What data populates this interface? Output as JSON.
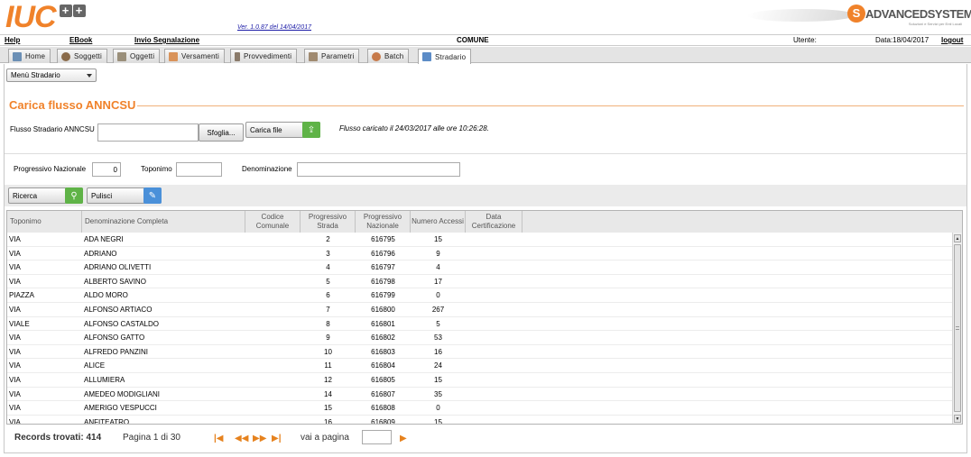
{
  "header": {
    "logo_text": "IUC",
    "logo_plus": [
      "+",
      "+"
    ],
    "version": "Ver. 1.0.87 del 14/04/2017",
    "brand_name": "ADVANCEDSYSTEMS",
    "brand_sub": "Soluzioni e Servizi per Enti Locali"
  },
  "topbar": {
    "help": "Help",
    "ebook": "EBook",
    "invio": "Invio Segnalazione",
    "comune": "COMUNE",
    "utente": "Utente:",
    "data": "Data:18/04/2017",
    "logout": "logout"
  },
  "tabs": [
    {
      "label": "Home",
      "icon": "home-icon",
      "color": "#6b8fb5"
    },
    {
      "label": "Soggetti",
      "icon": "person-icon",
      "color": "#8a6b4a"
    },
    {
      "label": "Oggetti",
      "icon": "building-icon",
      "color": "#9a8f7a"
    },
    {
      "label": "Versamenti",
      "icon": "money-icon",
      "color": "#d9935a"
    },
    {
      "label": "Provvedimenti",
      "icon": "document-icon",
      "color": "#8a7a6a"
    },
    {
      "label": "Parametri",
      "icon": "grid-icon",
      "color": "#a08a70"
    },
    {
      "label": "Batch",
      "icon": "gears-icon",
      "color": "#c77a4a"
    },
    {
      "label": "Stradario",
      "icon": "road-icon",
      "color": "#5c8cc7"
    }
  ],
  "menu_select": "Menù Stradario",
  "section_title": "Carica flusso ANNCSU",
  "upload": {
    "label": "Flusso Stradario ANNCSU",
    "browse": "Sfoglia...",
    "carica": "Carica file",
    "message": "Flusso caricato il 24/03/2017 alle ore 10:26:28."
  },
  "filters": {
    "progressivo_label": "Progressivo Nazionale",
    "progressivo_value": "0",
    "toponimo_label": "Toponimo",
    "toponimo_value": "",
    "denominazione_label": "Denominazione",
    "denominazione_value": ""
  },
  "buttons": {
    "ricerca": "Ricerca",
    "pulisci": "Pulisci"
  },
  "grid": {
    "columns": [
      "Toponimo",
      "Denominazione Completa",
      "Codice Comunale",
      "Progressivo Strada",
      "Progressivo Nazionale",
      "Numero Accessi",
      "Data Certificazione"
    ],
    "rows": [
      [
        "VIA",
        "ADA NEGRI",
        "",
        "2",
        "616795",
        "15",
        ""
      ],
      [
        "VIA",
        "ADRIANO",
        "",
        "3",
        "616796",
        "9",
        ""
      ],
      [
        "VIA",
        "ADRIANO OLIVETTI",
        "",
        "4",
        "616797",
        "4",
        ""
      ],
      [
        "VIA",
        "ALBERTO SAVINO",
        "",
        "5",
        "616798",
        "17",
        ""
      ],
      [
        "PIAZZA",
        "ALDO MORO",
        "",
        "6",
        "616799",
        "0",
        ""
      ],
      [
        "VIA",
        "ALFONSO ARTIACO",
        "",
        "7",
        "616800",
        "267",
        ""
      ],
      [
        "VIALE",
        "ALFONSO CASTALDO",
        "",
        "8",
        "616801",
        "5",
        ""
      ],
      [
        "VIA",
        "ALFONSO GATTO",
        "",
        "9",
        "616802",
        "53",
        ""
      ],
      [
        "VIA",
        "ALFREDO PANZINI",
        "",
        "10",
        "616803",
        "16",
        ""
      ],
      [
        "VIA",
        "ALICE",
        "",
        "11",
        "616804",
        "24",
        ""
      ],
      [
        "VIA",
        "ALLUMIERA",
        "",
        "12",
        "616805",
        "15",
        ""
      ],
      [
        "VIA",
        "AMEDEO MODIGLIANI",
        "",
        "14",
        "616807",
        "35",
        ""
      ],
      [
        "VIA",
        "AMERIGO VESPUCCI",
        "",
        "15",
        "616808",
        "0",
        ""
      ],
      [
        "VIA",
        "ANFITEATRO",
        "",
        "16",
        "616809",
        "15",
        ""
      ]
    ]
  },
  "pager": {
    "records": "Records trovati: 414",
    "page": "Pagina 1 di 30",
    "goto": "vai a pagina",
    "goto_value": ""
  }
}
